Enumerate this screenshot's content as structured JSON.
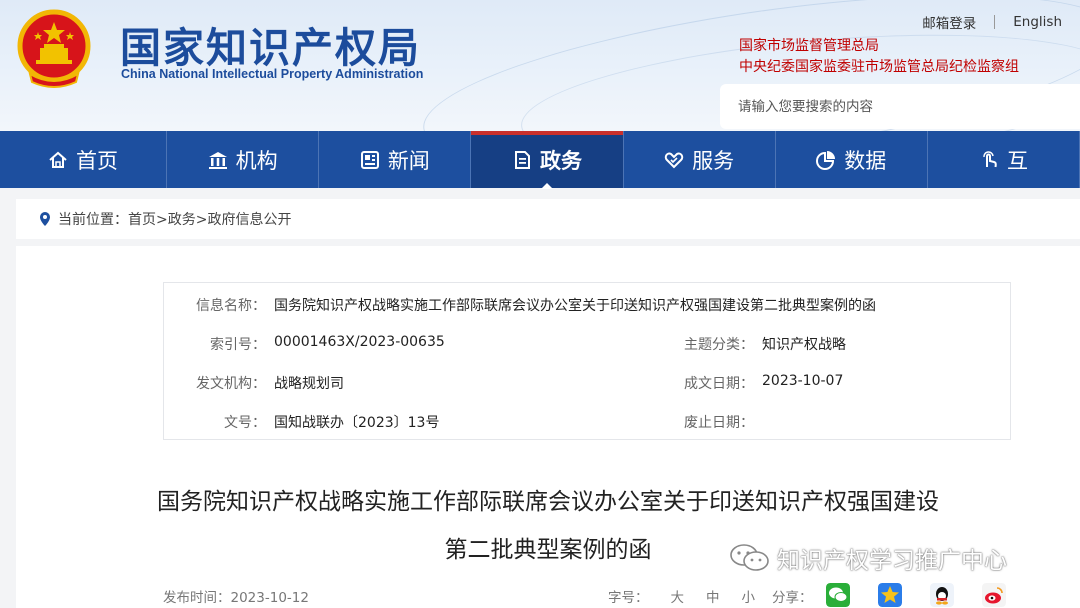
{
  "header": {
    "site_name_cn": "国家知识产权局",
    "site_name_en": "China National Intellectual Property Administration",
    "top_links": [
      "邮箱登录",
      "English"
    ],
    "related_links": [
      "国家市场监督管理总局",
      "中央纪委国家监委驻市场监管总局纪检监察组"
    ],
    "search_placeholder": "请输入您要搜索的内容"
  },
  "nav": {
    "items": [
      {
        "label": "首页",
        "icon": "home-icon"
      },
      {
        "label": "机构",
        "icon": "institution-icon"
      },
      {
        "label": "新闻",
        "icon": "newspaper-icon"
      },
      {
        "label": "政务",
        "icon": "document-icon",
        "active": true
      },
      {
        "label": "服务",
        "icon": "hand-heart-icon"
      },
      {
        "label": "数据",
        "icon": "pie-chart-icon"
      },
      {
        "label": "互",
        "icon": "touch-icon"
      }
    ]
  },
  "breadcrumb": {
    "prefix": "当前位置：",
    "path": "首页>政务>政府信息公开"
  },
  "info": {
    "name_label": "信息名称：",
    "name_value": "国务院知识产权战略实施工作部际联席会议办公室关于印送知识产权强国建设第二批典型案例的函",
    "index_label": "索引号：",
    "index_value": "00001463X/2023-00635",
    "topic_label": "主题分类：",
    "topic_value": "知识产权战略",
    "issuer_label": "发文机构：",
    "issuer_value": "战略规划司",
    "date_label": "成文日期：",
    "date_value": "2023-10-07",
    "docno_label": "文号：",
    "docno_value": "国知战联办〔2023〕13号",
    "abolish_label": "废止日期：",
    "abolish_value": ""
  },
  "document": {
    "title_line1": "国务院知识产权战略实施工作部际联席会议办公室关于印送知识产权强国建设",
    "title_line2": "第二批典型案例的函"
  },
  "meta": {
    "publish_label": "发布时间：",
    "publish_date": "2023-10-12",
    "font_label": "字号：",
    "font_sizes": [
      "大",
      "中",
      "小"
    ],
    "share_label": "分享：",
    "share_targets": [
      "wechat-icon",
      "qzone-icon",
      "qq-icon",
      "weibo-icon"
    ]
  },
  "watermark": {
    "text": "知识产权学习推广中心"
  },
  "colors": {
    "brand_blue": "#1d4f9f",
    "brand_red": "#c00000",
    "active_accent": "#c9302c"
  }
}
